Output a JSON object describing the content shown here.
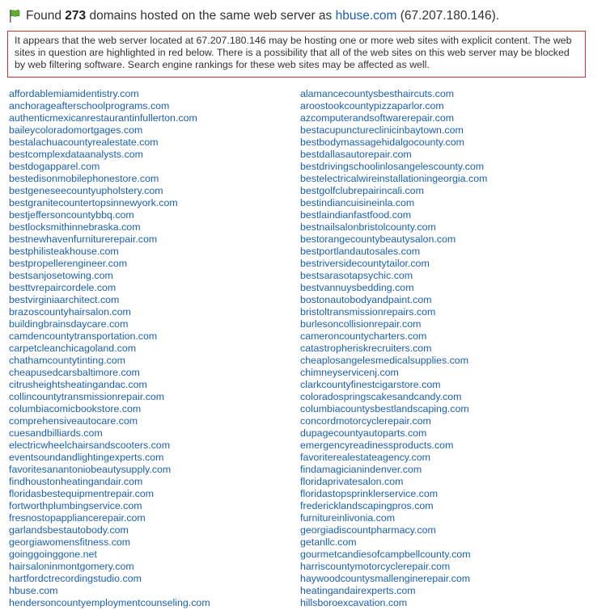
{
  "header": {
    "prefix": "Found",
    "count": "273",
    "middle": "domains hosted on the same web server as",
    "domain_link": "hbuse.com",
    "ip": "(67.207.180.146)."
  },
  "warning": {
    "text": "It appears that the web server located at 67.207.180.146 may be hosting one or more web sites with explicit content. The web sites in question are highlighted in red below. There is a possibility that all of the web sites on this web server may be blocked by web filtering software. Search engine rankings for these web sites may be affected as well."
  },
  "domains": {
    "left": [
      "affordablemiamidentistry.com",
      "anchorageafterschoolprograms.com",
      "authenticmexicanrestaurantinfullerton.com",
      "baileycoloradomortgages.com",
      "bestalachuacountyrealestate.com",
      "bestcomplexdataanalysts.com",
      "bestdogapparel.com",
      "bestedisonmobilephonestore.com",
      "bestgeneseecountyupholstery.com",
      "bestgranitecountertopsinnewyork.com",
      "bestjeffersoncountybbq.com",
      "bestlocksmithinnebraska.com",
      "bestnewhavenfurniturerepair.com",
      "bestphilisteakhouse.com",
      "bestpropellerengineer.com",
      "bestsanjosetowing.com",
      "besttvrepaircordele.com",
      "bestvirginiaarchitect.com",
      "brazoscountyhairsalon.com",
      "buildingbrainsdaycare.com",
      "camdencountytransportation.com",
      "carpetcleanchicagoland.com",
      "chathamcountytinting.com",
      "cheapusedcarsbaltimore.com",
      "citrusheightsheatingandac.com",
      "collincountytransmissionrepair.com",
      "columbiacomicbookstore.com",
      "comprehensiveautocare.com",
      "cuesandbilliards.com",
      "electricwheelchairsandscooters.com",
      "eventsoundandlightingexperts.com",
      "favoritesanantoniobeautysupply.com",
      "findhoustonheatingandair.com",
      "floridasbestequipmentrepair.com",
      "fortworthplumbingservice.com",
      "fresnostopappliancerepair.com",
      "garlandsbestautobody.com",
      "georgiawomensfitness.com",
      "goinggoinggone.net",
      "hairsaloninmontgomery.com",
      "hartfordctrecordingstudio.com",
      "hbuse.com",
      "hendersoncountyemploymentcounseling.com"
    ],
    "right": [
      "alamancecountysbesthaircuts.com",
      "aroostookcountypizzaparlor.com",
      "azcomputerandsoftwarerepair.com",
      "bestacupunctureclinicinbaytown.com",
      "bestbodymassagehidalgocounty.com",
      "bestdallasautorepair.com",
      "bestdrivingschoolinlosangelescounty.com",
      "bestelectricalwireinstallationingeorgia.com",
      "bestgolfclubrepairincali.com",
      "bestindiancuisineinla.com",
      "bestlaindianfastfood.com",
      "bestnailsalonbristolcounty.com",
      "bestorangecountybeautysalon.com",
      "bestportlandautosales.com",
      "bestriversidecountytailor.com",
      "bestsarasotapsychic.com",
      "bestvannuysbedding.com",
      "bostonautobodyandpaint.com",
      "bristoltransmissionrepairs.com",
      "burlesoncollisionrepair.com",
      "cameroncountycharters.com",
      "catastropheriskrecruiters.com",
      "cheaplosangelesmedicalsupplies.com",
      "chimneyservicenj.com",
      "clarkcountyfinestcigarstore.com",
      "coloradospringscakesandcandy.com",
      "columbiacountysbestlandscaping.com",
      "concordmotorcyclerepair.com",
      "dupagecountyautoparts.com",
      "emergencyreadinessproducts.com",
      "favoriterealestateagency.com",
      "findamagicianindenver.com",
      "floridaprivatesalon.com",
      "floridastopsprinklerservice.com",
      "fredericklandscapingpros.com",
      "furnitureinlivonia.com",
      "georgiadiscountpharmacy.com",
      "getanllc.com",
      "gourmetcandiesofcampbellcounty.com",
      "harriscountymotorcyclerepair.com",
      "haywoodcountysmallenginerepair.com",
      "heatingandairexperts.com",
      "hillsboroexcavation.com"
    ]
  }
}
